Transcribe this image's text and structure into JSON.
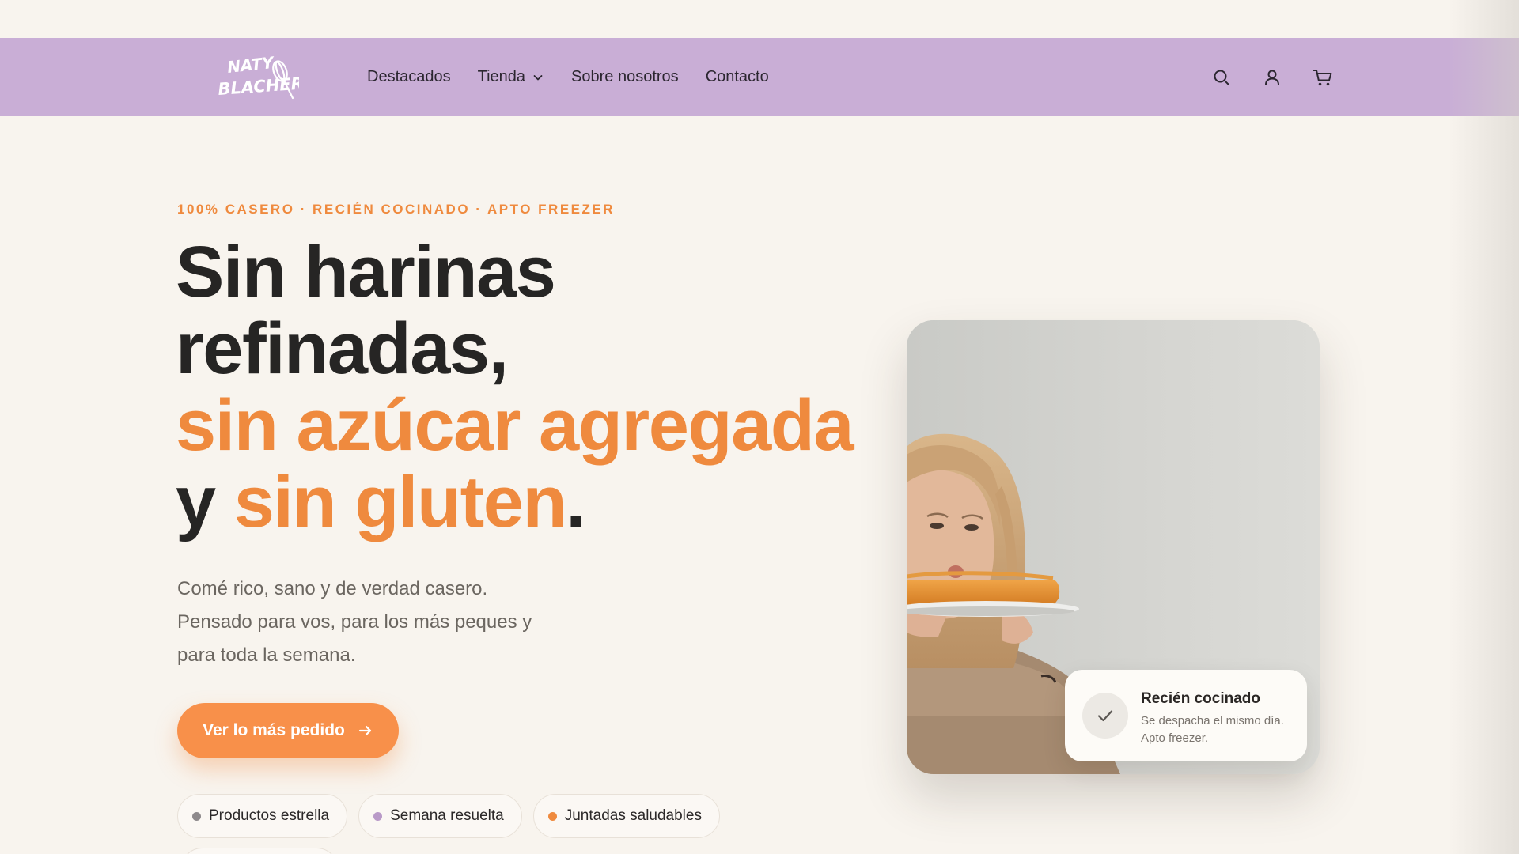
{
  "brand": {
    "logo_line1": "NATY",
    "logo_line2": "BLACHER",
    "header_color": "#c9aed6",
    "accent_color": "#ef8a3e"
  },
  "nav": {
    "items": [
      {
        "label": "Destacados"
      },
      {
        "label": "Tienda",
        "has_dropdown": true
      },
      {
        "label": "Sobre nosotros"
      },
      {
        "label": "Contacto"
      }
    ]
  },
  "header_icons": [
    "search-icon",
    "user-icon",
    "cart-icon"
  ],
  "hero": {
    "eyebrow": "100% CASERO · RECIÉN COCINADO · APTO FREEZER",
    "headline": {
      "line1": "Sin harinas",
      "line2": "refinadas,",
      "line3": "sin azúcar agregada",
      "line4_prefix": "y ",
      "line4_accent": "sin gluten",
      "line4_suffix": "."
    },
    "subtext": {
      "line1": "Comé rico, sano y de verdad casero.",
      "line2": "Pensado para vos, para los más peques y",
      "line3": "para toda la semana."
    },
    "cta_label": "Ver lo más pedido",
    "chips": [
      {
        "label": "Productos estrella",
        "dot_color": "#8e8a8c"
      },
      {
        "label": "Semana resuelta",
        "dot_color": "#b99ac8"
      },
      {
        "label": "Juntadas saludables",
        "dot_color": "#ef8a3e"
      }
    ]
  },
  "badge": {
    "title": "Recién cocinado",
    "description": "Se despacha el mismo día. Apto freezer."
  }
}
